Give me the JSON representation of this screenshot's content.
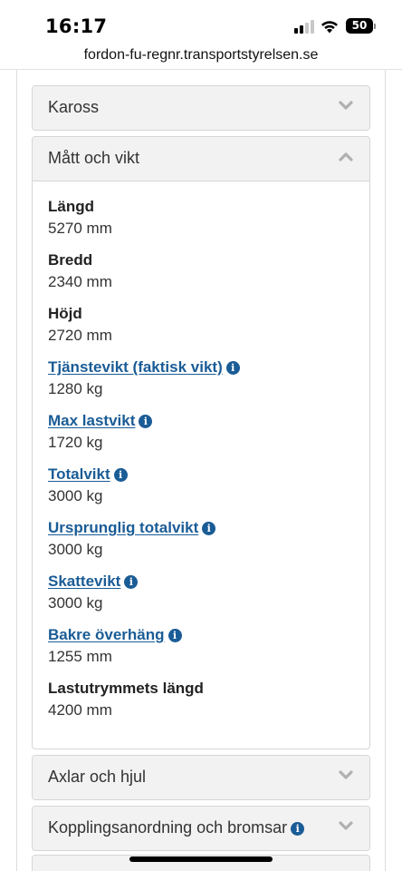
{
  "status_bar": {
    "time": "16:17",
    "battery": "50",
    "signal_bars_on": 2,
    "signal_bars_total": 4
  },
  "browser": {
    "url": "fordon-fu-regnr.transportstyrelsen.se"
  },
  "sections": {
    "kaross": {
      "title": "Kaross",
      "chevron": "chevron-down-icon"
    },
    "matt": {
      "title": "Mått och vikt",
      "chevron": "chevron-up-icon",
      "items": [
        {
          "label": "Längd",
          "value": "5270 mm"
        },
        {
          "label": "Bredd",
          "value": "2340 mm"
        },
        {
          "label": "Höjd",
          "value": "2720 mm"
        },
        {
          "label": "Tjänstevikt (faktisk vikt)",
          "value": "1280 kg"
        },
        {
          "label": "Max lastvikt",
          "value": "1720 kg"
        },
        {
          "label": "Totalvikt",
          "value": "3000 kg"
        },
        {
          "label": "Ursprunglig totalvikt",
          "value": "3000 kg"
        },
        {
          "label": "Skattevikt",
          "value": "3000 kg"
        },
        {
          "label": "Bakre överhäng",
          "value": "1255 mm"
        },
        {
          "label": "Lastutrymmets längd",
          "value": "4200 mm"
        }
      ]
    },
    "axlar": {
      "title": "Axlar och hjul",
      "chevron": "chevron-down-icon"
    },
    "koppling": {
      "title": "Kopplingsanordning och bromsar",
      "chevron": "chevron-down-icon"
    }
  },
  "colors": {
    "link": "#1a5c96",
    "panel_header_bg": "#f2f2f2",
    "border": "#d6d6d6",
    "chevron": "#b0b0b0"
  },
  "info_icon_glyph": "i"
}
